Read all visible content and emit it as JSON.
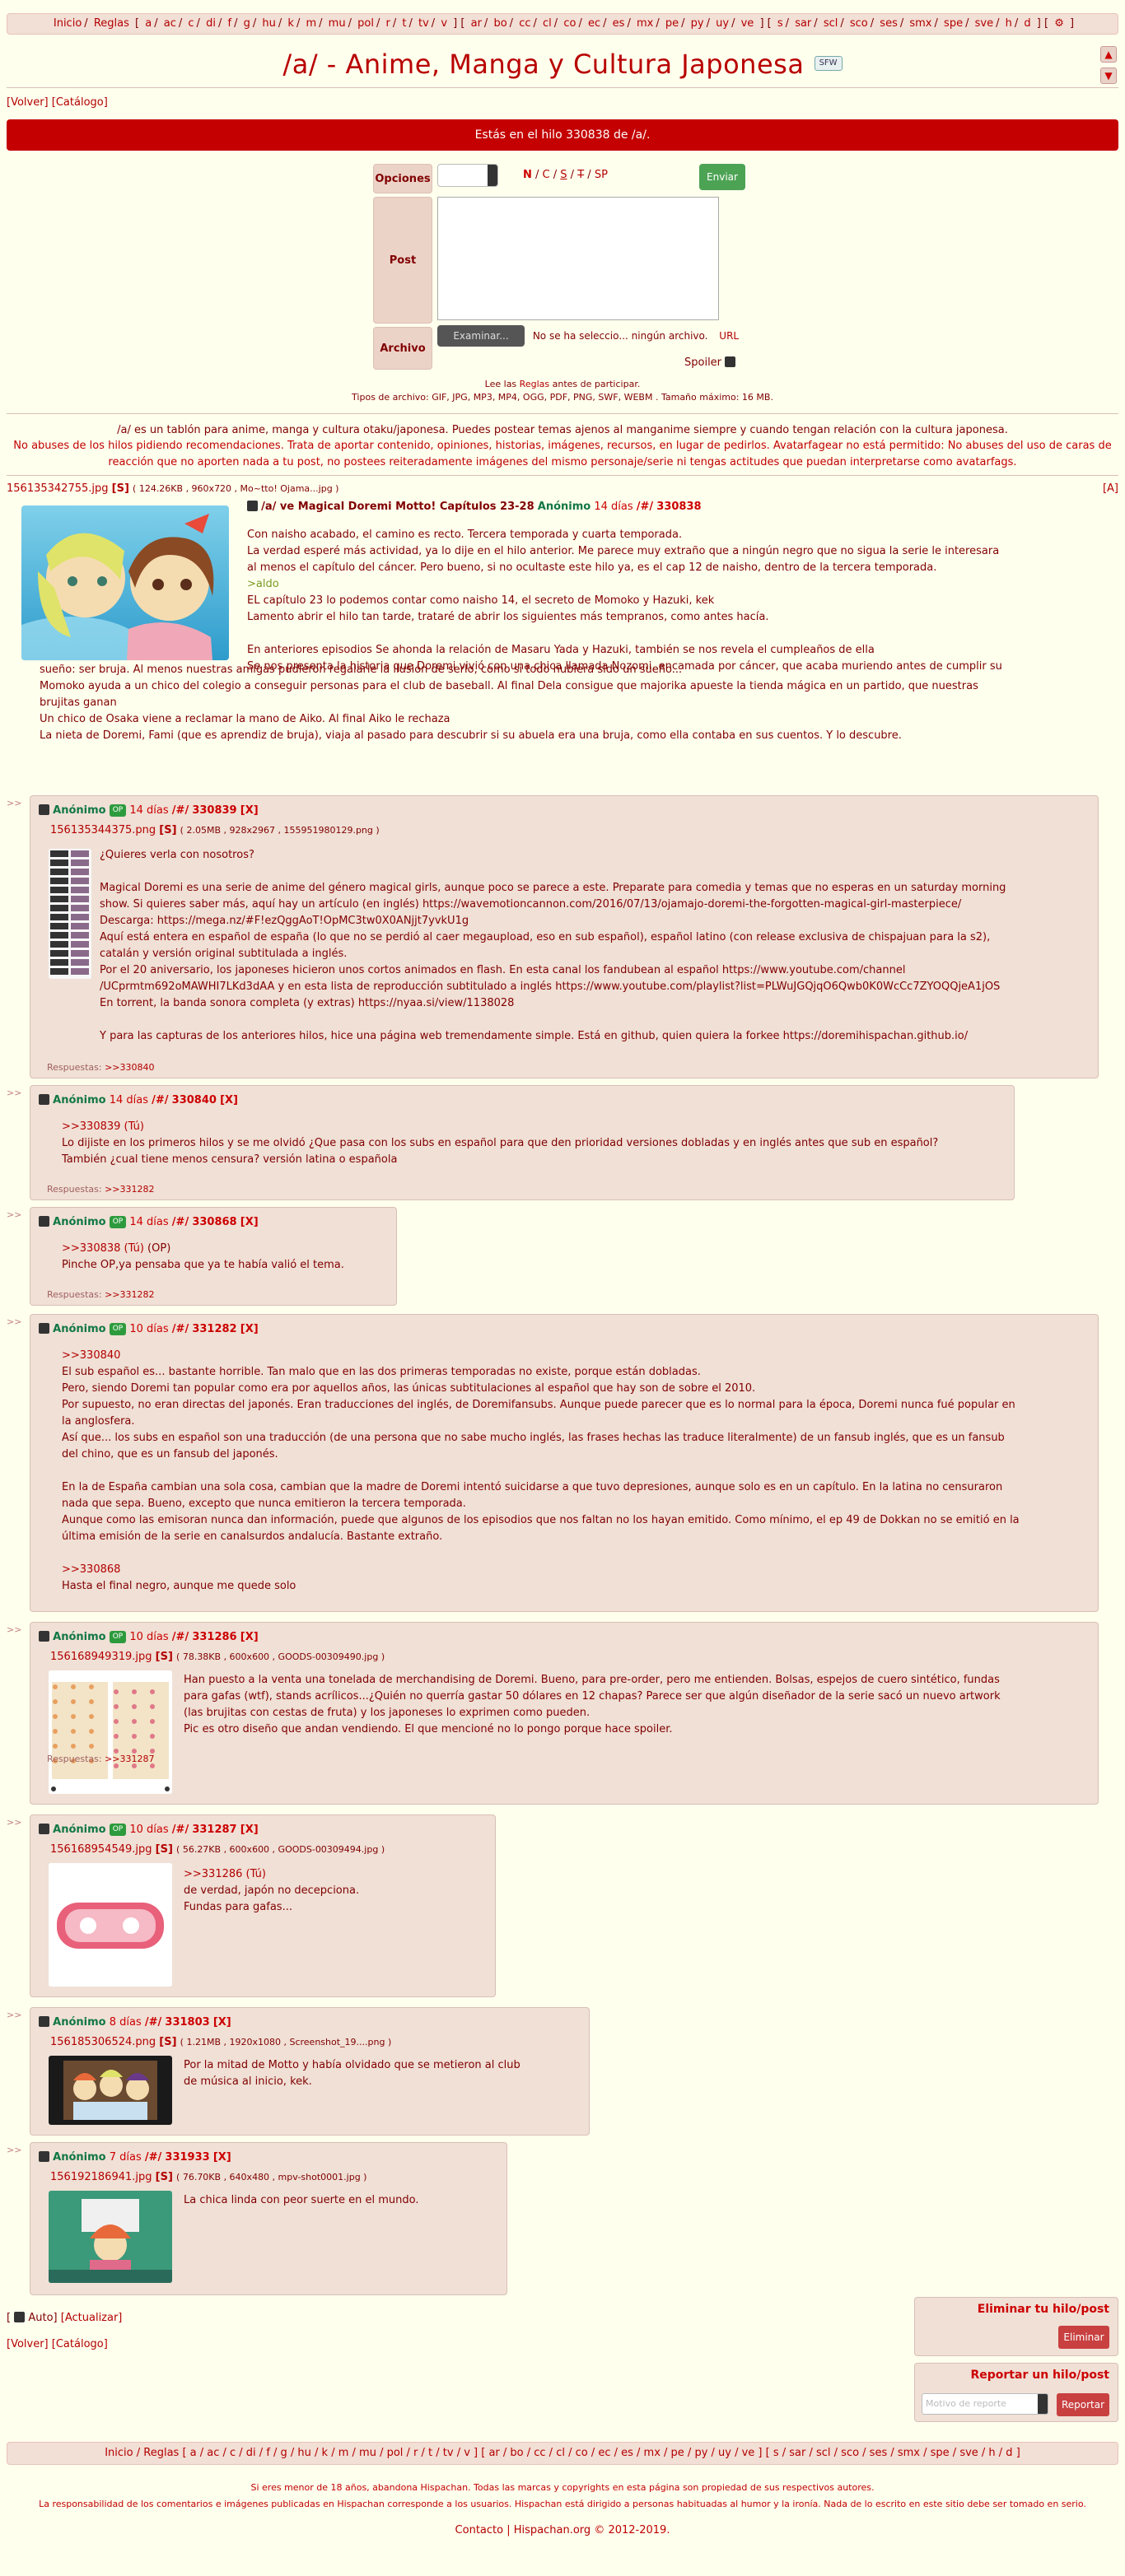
{
  "top_nav": {
    "items": [
      "Inicio",
      "Reglas",
      "[",
      "a",
      "ac",
      "c",
      "di",
      "f",
      "g",
      "hu",
      "k",
      "m",
      "mu",
      "pol",
      "r",
      "t",
      "tv",
      "v",
      "]",
      "[",
      "ar",
      "bo",
      "cc",
      "cl",
      "co",
      "ec",
      "es",
      "mx",
      "pe",
      "py",
      "uy",
      "ve",
      "]",
      "[",
      "s",
      "sar",
      "scl",
      "sco",
      "ses",
      "smx",
      "spe",
      "sve",
      "h",
      "d",
      "]",
      "[",
      "⚙",
      "]"
    ]
  },
  "header": {
    "title": "/a/ - Anime, Manga y Cultura Japonesa",
    "badge": "SFW",
    "up_arrow": "▲",
    "down_arrow": "▼"
  },
  "back": {
    "volver": "[Volver]",
    "catalogo": "[Catálogo]"
  },
  "banner": "Estás en el hilo 330838 de /a/.",
  "form": {
    "opciones_label": "Opciones",
    "mode_n": "N",
    "mode_c": "C",
    "mode_s": "S",
    "mode_t": "T",
    "mode_sp": "SP",
    "send": "Enviar",
    "post_label": "Post",
    "archivo_label": "Archivo",
    "examinar": "Examinar...",
    "no_file": "No se ha selecciο... ningún archivo.",
    "url": "URL",
    "spoiler": "Spoiler"
  },
  "rules": {
    "pre": "Lee las",
    "link": "Reglas",
    "post": "antes de participar.",
    "filetypes": "Tipos de archivo: GIF, JPG, MP3, MP4, OGG, PDF, PNG, SWF, WEBM . Tamaño máximo: 16 MB."
  },
  "board_desc": {
    "line1": "/a/ es un tablón para anime, manga y cultura otaku/japonesa. Puedes postear temas ajenos al manganime siempre y cuando tengan relación con la cultura japonesa.",
    "line2": "No abuses de los hilos pidiendo recomendaciones. Trata de aportar contenido, opiniones, historias, imágenes, recursos, en lugar de pedirlos. Avatarfagear no está permitido: No abuses del uso de caras de reacción que no aporten nada a tu post, no postees reiteradamente imágenes del mismo personaje/serie ni tengas actitudes que puedan interpretarse como avatarfags."
  },
  "op": {
    "file": "156135342755.jpg",
    "s": "[S]",
    "meta": "( 124.26KB , 960x720 , Mo~tto! Ojama...jpg )",
    "a_tag": "[A]",
    "subject": "/a/ ve Magical Doremi Motto! Capítulos 23-28",
    "name": "Anónimo",
    "date": "14 días",
    "board": "/#/",
    "num": "330838",
    "body_lines": [
      {
        "t": "Con naisho acabado, el camino es recto. Tercera temporada y cuarta temporada.",
        "g": false
      },
      {
        "t": "La verdad esperé más actividad, ya lo dije en el hilo anterior. Me parece muy extraño que a ningún negro que no sigua la serie le interesara",
        "g": false
      },
      {
        "t": "al menos el capítulo del cáncer. Pero bueno, si no ocultaste este hilo ya, es el cap 12 de naisho, dentro de la tercera temporada.",
        "g": false
      },
      {
        "t": ">aldo",
        "g": true
      },
      {
        "t": "EL capítulo 23 lo podemos contar como naisho 14, el secreto de Momoko y Hazuki, kek",
        "g": false
      },
      {
        "t": "Lamento abrir el hilo tan tarde, trataré de abrir los siguientes más tempranos, como antes hacía.",
        "g": false
      },
      {
        "t": "",
        "g": false
      },
      {
        "t": "En anteriores episodios Se ahonda la relación de Masaru Yada y Hazuki, también se nos revela el cumpleaños de ella",
        "g": false
      },
      {
        "t": "Se nos presenta la historia que Doremi vivió con una chica llamada Nozomi, encamada por cáncer, que acaba muriendo antes de cumplir su",
        "g": false
      }
    ],
    "body_lines2": [
      "sueño: ser bruja. Al menos nuestras amigas pudieron regalarle la ilusión de serlo, como si todo hubiera sido un sueño...",
      "Momoko ayuda a un chico del colegio a conseguir personas para el club de baseball. Al final Dela consigue que majorika apueste la tienda mágica en un partido, que nuestras",
      "brujitas ganan",
      "Un chico de Osaka viene a reclamar la mano de Aiko. Al final Aiko le rechaza",
      "La nieta de Doremi, Fami (que es aprendiz de bruja), viaja al pasado para descubrir si su abuela era una bruja, como ella contaba en sus cuentos. Y lo descubre."
    ]
  },
  "replies": [
    {
      "name": "Anónimo",
      "op": "OP",
      "date": "14 días",
      "board": "/#/",
      "num": "330839",
      "x": "[X]",
      "file": "156135344375.png",
      "s": "[S]",
      "meta": "( 2.05MB , 928x2967 , 155951980129.png )",
      "lines": [
        "¿Quieres verla con nosotros?",
        "",
        "Magical Doremi es una serie de anime del género magical girls, aunque poco se parece a este. Preparate para comedia y temas que no esperas en un saturday morning",
        "show. Si quieres saber más, aquí hay un artículo (en inglés) https://wavemotioncannon.com/2016/07/13/ojamajo-doremi-the-forgotten-magical-girl-masterpiece/",
        "Descarga: https://mega.nz/#F!ezQggAoT!OpMC3tw0X0ANjjt7yvkU1g",
        "Aquí está entera en español de españa (lo que no se perdió al caer megaupload, eso en sub español), español latino (con release exclusiva de chispajuan para la s2),",
        "catalán y versión original subtitulada a inglés.",
        "Por el 20 aniversario, los japoneses hicieron unos cortos animados en flash. En esta canal los fandubean al español https://www.youtube.com/channel",
        "/UCprmtm692oMAWHI7LKd3dAA y en esta lista de reproducción subtitulado a inglés https://www.youtube.com/playlist?list=PLWuJGQjqO6Qwb0K0WcCc7ZYOQQjeA1jOS",
        "En torrent, la banda sonora completa (y extras) https://nyaa.si/view/1138028",
        "",
        "Y para las capturas de los anteriores hilos, hice una página web tremendamente simple. Está en github, quien quiera la forkee https://doremihispachan.github.io/"
      ],
      "resp_label": "Respuestas:",
      "resp": ">>330840"
    },
    {
      "name": "Anónimo",
      "date": "14 días",
      "board": "/#/",
      "num": "330840",
      "x": "[X]",
      "lines": [
        ">>330839 (Tú)",
        "Lo dijiste en los primeros hilos y se me olvidó ¿Que pasa con los subs en español para que den prioridad versiones dobladas y en inglés antes que sub en español?",
        "También ¿cual tiene menos censura? versión latina o española"
      ],
      "resp_label": "Respuestas:",
      "resp": ">>331282"
    },
    {
      "name": "Anónimo",
      "op": "OP",
      "date": "14 días",
      "board": "/#/",
      "num": "330868",
      "x": "[X]",
      "quote": ">>330838 (Tú)",
      "quote_suffix": "(OP)",
      "lines": [
        "Pinche OP,ya pensaba que ya te había valió el tema."
      ],
      "resp_label": "Respuestas:",
      "resp": ">>331282"
    },
    {
      "name": "Anónimo",
      "op": "OP",
      "date": "10 días",
      "board": "/#/",
      "num": "331282",
      "x": "[X]",
      "lines": [
        ">>330840",
        "El sub español es... bastante horrible. Tan malo que en las dos primeras temporadas no existe, porque están dobladas.",
        "Pero, siendo Doremi tan popular como era por aquellos años, las únicas subtitulaciones al español que hay son de sobre el 2010.",
        "Por supuesto, no eran directas del japonés. Eran traducciones del inglés, de Doremifansubs. Aunque puede parecer que es lo normal para la época, Doremi nunca fué popular en",
        "la anglosfera.",
        "Así que... los subs en español son una traducción (de una persona que no sabe mucho inglés, las frases hechas las traduce literalmente) de un fansub inglés, que es un fansub",
        "del chino, que es un fansub del japonés.",
        "",
        "En la de España cambian una sola cosa, cambian que la madre de Doremi intentó suicidarse a que tuvo depresiones, aunque solo es en un capítulo. En la latina no censuraron",
        "nada que sepa. Bueno, excepto que nunca emitieron la tercera temporada.",
        "Aunque como las emisoran nunca dan información, puede que algunos de los episodios que nos faltan no los hayan emitido. Como mínimo, el ep 49 de Dokkan no se emitió en la",
        "última emisión de la serie en canalsurdos andalucía. Bastante extraño.",
        "",
        ">>330868",
        "Hasta el final negro, aunque me quede solo"
      ]
    },
    {
      "name": "Anónimo",
      "op": "OP",
      "date": "10 días",
      "board": "/#/",
      "num": "331286",
      "x": "[X]",
      "file": "156168949319.jpg",
      "s": "[S]",
      "meta": "( 78.38KB , 600x600 , GOODS-00309490.jpg )",
      "lines": [
        "Han puesto a la venta una tonelada de merchandising de Doremi. Bueno, para pre-order, pero me entienden. Bolsas, espejos de cuero sintético, fundas",
        "para gafas (wtf), stands acrílicos...¿Quién no querría gastar 50 dólares en 12 chapas? Parece ser que algún diseñador de la serie sacó un nuevo artwork",
        "(las brujitas con cestas de fruta) y los japoneses lo exprimen como pueden.",
        "Pic es otro diseño que andan vendiendo. El que mencioné no lo pongo porque hace spoiler."
      ],
      "resp_label": "Respuestas:",
      "resp": ">>331287"
    },
    {
      "name": "Anónimo",
      "op": "OP",
      "date": "10 días",
      "board": "/#/",
      "num": "331287",
      "x": "[X]",
      "file": "156168954549.jpg",
      "s": "[S]",
      "meta": "( 56.27KB , 600x600 , GOODS-00309494.jpg )",
      "lines": [
        ">>331286 (Tú)",
        "de verdad, japón no decepciona.",
        "Fundas para gafas..."
      ]
    },
    {
      "name": "Anónimo",
      "date": "8 días",
      "board": "/#/",
      "num": "331803",
      "x": "[X]",
      "file": "156185306524.png",
      "s": "[S]",
      "meta": "( 1.21MB , 1920x1080 , Screenshot_19....png )",
      "lines": [
        "Por la mitad de Motto y había olvidado que se metieron al club",
        "de música al inicio, kek."
      ]
    },
    {
      "name": "Anónimo",
      "date": "7 días",
      "board": "/#/",
      "num": "331933",
      "x": "[X]",
      "file": "156192186941.jpg",
      "s": "[S]",
      "meta": "( 76.70KB , 640x480 , mpv-shot0001.jpg )",
      "lines": [
        "La chica linda con peor suerte en el mundo."
      ]
    }
  ],
  "bottom": {
    "auto": "Auto",
    "actualizar": "[Actualizar]",
    "volver": "[Volver]",
    "catalogo": "[Catálogo]",
    "delete_title": "Eliminar tu hilo/post",
    "delete_btn": "Eliminar",
    "report_title": "Reportar un hilo/post",
    "report_placeholder": "Motivo de reporte",
    "report_btn": "Reportar"
  },
  "footer": {
    "nav": "Inicio / Reglas [ a / ac / c / di / f / g / hu / k / m / mu / pol / r / t / tv / v ] [ ar / bo / cc / cl / co / ec / es / mx / pe / py / uy / ve ] [ s / sar / scl / sco / ses / smx / spe / sve / h / d ]",
    "line1": "Si eres menor de 18 años, abandona Hispachan. Todas las marcas y copyrights en esta página son propiedad de sus respectivos autores.",
    "line2": "La responsabilidad de los comentarios e imágenes publicadas en Hispachan corresponde a los usuarios. Hispachan está dirigido a personas habituadas al humor y la ironía. Nada de lo escrito en este sitio debe ser tomado en serio.",
    "contacto": "Contacto",
    "site": "Hispachan.org",
    "copy": "© 2012-2019."
  },
  "colors": {
    "accent": "#c40000",
    "post_bg": "#f0e0d6",
    "page_bg": "#ffffee",
    "name": "#117743",
    "greentext": "#789922",
    "op_badge": "#2d9b3d"
  }
}
